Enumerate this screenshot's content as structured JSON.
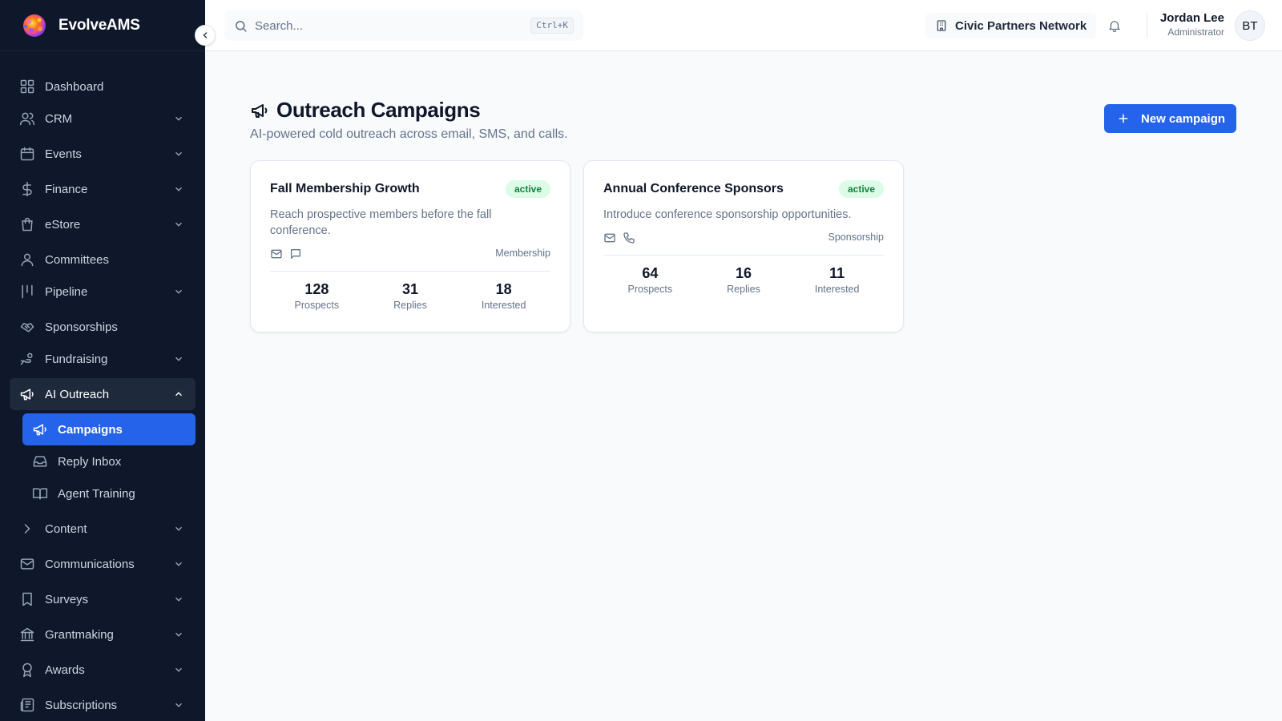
{
  "brand": {
    "name": "EvolveAMS"
  },
  "sidebar": {
    "items": [
      {
        "label": "Dashboard",
        "icon": "layout-grid-icon"
      },
      {
        "label": "CRM",
        "icon": "users-icon"
      },
      {
        "label": "Events",
        "icon": "calendar-icon"
      },
      {
        "label": "Finance",
        "icon": "dollar-icon"
      },
      {
        "label": "eStore",
        "icon": "shopping-bag-icon"
      },
      {
        "label": "Committees",
        "icon": "user-icon"
      },
      {
        "label": "Pipeline",
        "icon": "kanban-icon"
      },
      {
        "label": "Sponsorships",
        "icon": "handshake-icon"
      },
      {
        "label": "Fundraising",
        "icon": "hand-coins-icon"
      },
      {
        "label": "AI Outreach",
        "icon": "megaphone-icon"
      },
      {
        "label": "Campaigns",
        "icon": "megaphone-icon"
      },
      {
        "label": "Reply Inbox",
        "icon": "inbox-icon"
      },
      {
        "label": "Agent Training",
        "icon": "book-open-icon"
      },
      {
        "label": "Content",
        "icon": "chevron-right-icon"
      },
      {
        "label": "Communications",
        "icon": "mail-icon"
      },
      {
        "label": "Surveys",
        "icon": "bookmark-icon"
      },
      {
        "label": "Grantmaking",
        "icon": "landmark-icon"
      },
      {
        "label": "Awards",
        "icon": "award-icon"
      },
      {
        "label": "Subscriptions",
        "icon": "newspaper-icon"
      }
    ]
  },
  "topbar": {
    "search_placeholder": "Search...",
    "search_shortcut": "Ctrl+K",
    "organization": "Civic Partners Network",
    "user_name": "Jordan Lee",
    "user_role": "Administrator",
    "avatar_initials": "BT"
  },
  "page": {
    "title": "Outreach Campaigns",
    "subtitle": "AI-powered cold outreach across email, SMS, and calls.",
    "new_button": "New campaign"
  },
  "campaigns": [
    {
      "title": "Fall Membership Growth",
      "status": "active",
      "description": "Reach prospective members before the fall conference.",
      "channels": [
        "mail-icon",
        "message-square-icon"
      ],
      "category": "Membership",
      "stats": [
        {
          "value": "128",
          "label": "Prospects"
        },
        {
          "value": "31",
          "label": "Replies"
        },
        {
          "value": "18",
          "label": "Interested"
        }
      ]
    },
    {
      "title": "Annual Conference Sponsors",
      "status": "active",
      "description": "Introduce conference sponsorship opportunities.",
      "channels": [
        "mail-icon",
        "phone-icon"
      ],
      "category": "Sponsorship",
      "stats": [
        {
          "value": "64",
          "label": "Prospects"
        },
        {
          "value": "16",
          "label": "Replies"
        },
        {
          "value": "11",
          "label": "Interested"
        }
      ]
    }
  ],
  "colors": {
    "sidebar_bg": "#0f172a",
    "accent": "#2563eb",
    "badge_bg": "#dcfce7",
    "badge_text": "#15803d"
  }
}
